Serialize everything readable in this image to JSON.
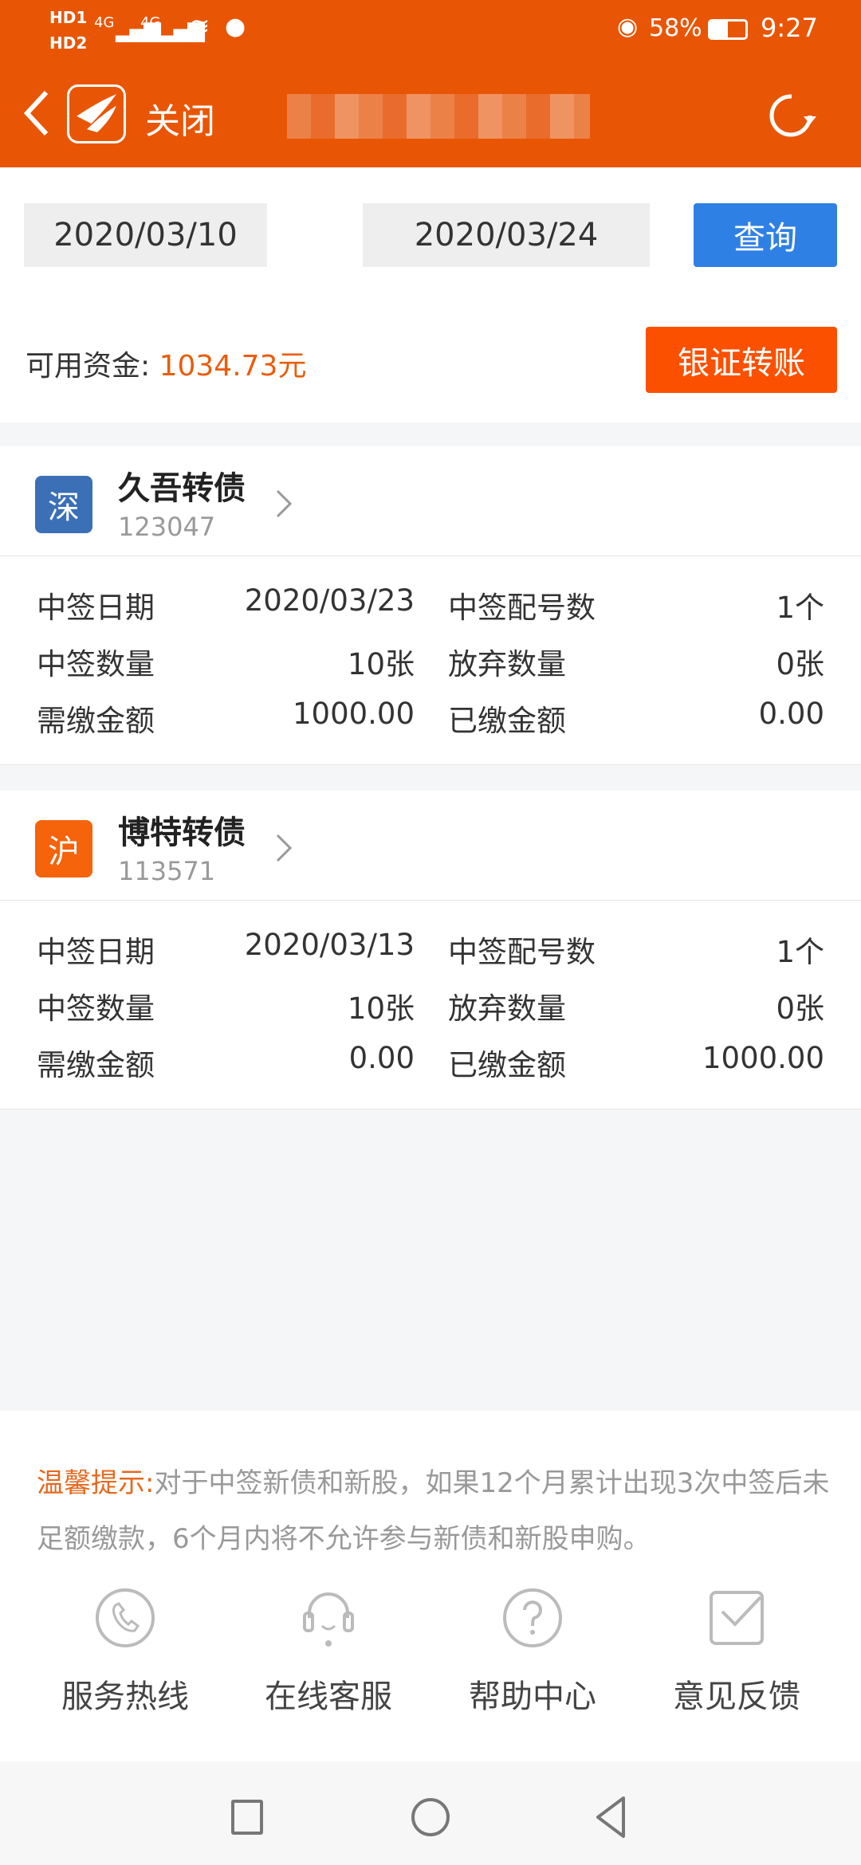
{
  "status_bar": {
    "sim1": "HD1",
    "sim2": "HD2",
    "network": "4G",
    "battery": "58%",
    "time": "9:27"
  },
  "header": {
    "close_label": "关闭"
  },
  "query": {
    "start_date": "2020/03/10",
    "end_date": "2020/03/24",
    "query_label": "查询"
  },
  "funds": {
    "label": "可用资金: ",
    "value": "1034.73元",
    "transfer_label": "银证转账"
  },
  "bonds": [
    {
      "market": "深",
      "market_color": "#3b6fb6",
      "name": "久吾转债",
      "code": "123047",
      "rows": [
        [
          "中签日期",
          "2020/03/23",
          "中签配号数",
          "1个"
        ],
        [
          "中签数量",
          "10张",
          "放弃数量",
          "0张"
        ],
        [
          "需缴金额",
          "1000.00",
          "已缴金额",
          "0.00"
        ]
      ]
    },
    {
      "market": "沪",
      "market_color": "#f5630a",
      "name": "博特转债",
      "code": "113571",
      "rows": [
        [
          "中签日期",
          "2020/03/13",
          "中签配号数",
          "1个"
        ],
        [
          "中签数量",
          "10张",
          "放弃数量",
          "0张"
        ],
        [
          "需缴金额",
          "0.00",
          "已缴金额",
          "1000.00"
        ]
      ]
    }
  ],
  "tip": {
    "title": "温馨提示:",
    "text": "对于中签新债和新股，如果12个月累计出现3次中签后未足额缴款，6个月内将不允许参与新债和新股申购。"
  },
  "services": [
    {
      "label": "服务热线",
      "icon": "phone-icon"
    },
    {
      "label": "在线客服",
      "icon": "headset-icon"
    },
    {
      "label": "帮助中心",
      "icon": "help-icon"
    },
    {
      "label": "意见反馈",
      "icon": "feedback-icon"
    }
  ]
}
